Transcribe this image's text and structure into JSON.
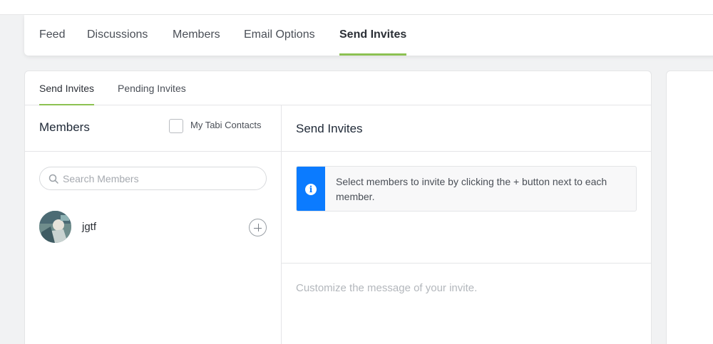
{
  "nav": {
    "tabs": [
      {
        "label": "Feed"
      },
      {
        "label": "Discussions"
      },
      {
        "label": "Members"
      },
      {
        "label": "Email Options"
      },
      {
        "label": "Send Invites",
        "active": true
      }
    ]
  },
  "subtabs": [
    {
      "label": "Send Invites",
      "active": true
    },
    {
      "label": "Pending Invites"
    }
  ],
  "members_panel": {
    "title": "Members",
    "contacts_checkbox_label": "My Tabi Contacts",
    "search_placeholder": "Search Members",
    "members": [
      {
        "name": "jgtf"
      }
    ]
  },
  "invite_panel": {
    "title": "Send Invites",
    "info_message": "Select members to invite by clicking the + button next to each member.",
    "message_placeholder": "Customize the message of your invite."
  },
  "colors": {
    "accent": "#8cc152",
    "info": "#0b7bff"
  },
  "icons": [
    "search-icon",
    "info-icon",
    "add-member-icon"
  ]
}
